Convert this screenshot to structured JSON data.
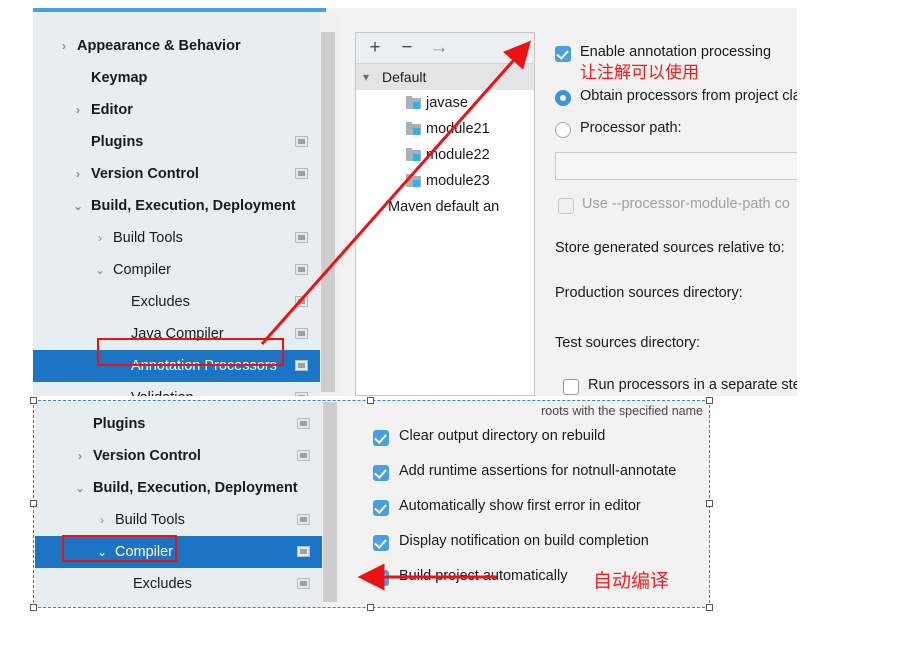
{
  "top_screenshot": {
    "sidebar": {
      "items": [
        {
          "label": "Appearance & Behavior",
          "arrow": "chevron-right",
          "indent": 44,
          "bold": true,
          "badge": false,
          "selected": false
        },
        {
          "label": "Keymap",
          "arrow": "",
          "indent": 58,
          "bold": true,
          "badge": false,
          "selected": false
        },
        {
          "label": "Editor",
          "arrow": "chevron-right",
          "indent": 58,
          "bold": true,
          "badge": false,
          "selected": false
        },
        {
          "label": "Plugins",
          "arrow": "",
          "indent": 58,
          "bold": true,
          "badge": true,
          "selected": false
        },
        {
          "label": "Version Control",
          "arrow": "chevron-right",
          "indent": 58,
          "bold": true,
          "badge": true,
          "selected": false
        },
        {
          "label": "Build, Execution, Deployment",
          "arrow": "chevron-down",
          "indent": 58,
          "bold": true,
          "badge": false,
          "selected": false
        },
        {
          "label": "Build Tools",
          "arrow": "chevron-right",
          "indent": 80,
          "bold": false,
          "badge": true,
          "selected": false
        },
        {
          "label": "Compiler",
          "arrow": "chevron-down",
          "indent": 80,
          "bold": false,
          "badge": true,
          "selected": false
        },
        {
          "label": "Excludes",
          "arrow": "",
          "indent": 98,
          "bold": false,
          "badge": true,
          "selected": false
        },
        {
          "label": "Java Compiler",
          "arrow": "",
          "indent": 98,
          "bold": false,
          "badge": true,
          "selected": false
        },
        {
          "label": "Annotation Processors",
          "arrow": "",
          "indent": 98,
          "bold": false,
          "badge": true,
          "selected": true
        },
        {
          "label": "Validation",
          "arrow": "",
          "indent": 98,
          "bold": false,
          "badge": true,
          "selected": false
        }
      ]
    },
    "middle_panel": {
      "toolbar": {
        "add": "+",
        "remove": "−",
        "move": "→"
      },
      "group_label": "Default",
      "modules": [
        "javase",
        "module21",
        "module22",
        "module23"
      ],
      "footer_item": "Maven default an"
    },
    "right_panel": {
      "enable_annotation_processing": {
        "label": "Enable annotation processing",
        "checked": true
      },
      "obtain_from_project_classpath": {
        "label": "Obtain processors from project cla",
        "selected": true
      },
      "processor_path": {
        "label": "Processor path:",
        "selected": false,
        "value": ""
      },
      "use_processor_module_path": {
        "label": "Use --processor-module-path co",
        "checked": false,
        "disabled": true
      },
      "store_generated_sources_label": "Store generated sources relative to:",
      "production_sources_label": "Production sources directory:",
      "test_sources_label": "Test sources directory:",
      "run_processors_separate_step": {
        "label": "Run processors in a separate step",
        "checked": false
      }
    }
  },
  "bottom_screenshot": {
    "sidebar": {
      "items": [
        {
          "label": "Plugins",
          "arrow": "",
          "indent": 58,
          "bold": true,
          "badge": true,
          "selected": false
        },
        {
          "label": "Version Control",
          "arrow": "chevron-right",
          "indent": 58,
          "bold": true,
          "badge": true,
          "selected": false
        },
        {
          "label": "Build, Execution, Deployment",
          "arrow": "chevron-down",
          "indent": 58,
          "bold": true,
          "badge": false,
          "selected": false
        },
        {
          "label": "Build Tools",
          "arrow": "chevron-right",
          "indent": 80,
          "bold": false,
          "badge": true,
          "selected": false
        },
        {
          "label": "Compiler",
          "arrow": "chevron-down",
          "indent": 80,
          "bold": false,
          "badge": true,
          "selected": true
        },
        {
          "label": "Excludes",
          "arrow": "",
          "indent": 98,
          "bold": false,
          "badge": true,
          "selected": false
        }
      ]
    },
    "right_panel": {
      "hint_text": "roots with the specified name",
      "options": [
        {
          "label": "Clear output directory on rebuild",
          "checked": true
        },
        {
          "label": "Add runtime assertions for notnull-annotate",
          "checked": true
        },
        {
          "label": "Automatically show first error in editor",
          "checked": true
        },
        {
          "label": "Display notification on build completion",
          "checked": true
        },
        {
          "label": "Build project automatically",
          "checked": true
        }
      ]
    }
  },
  "annotations": {
    "note_enable": "让注解可以使用",
    "note_autobuild": "自动编译",
    "red_color": "#ee1111"
  }
}
